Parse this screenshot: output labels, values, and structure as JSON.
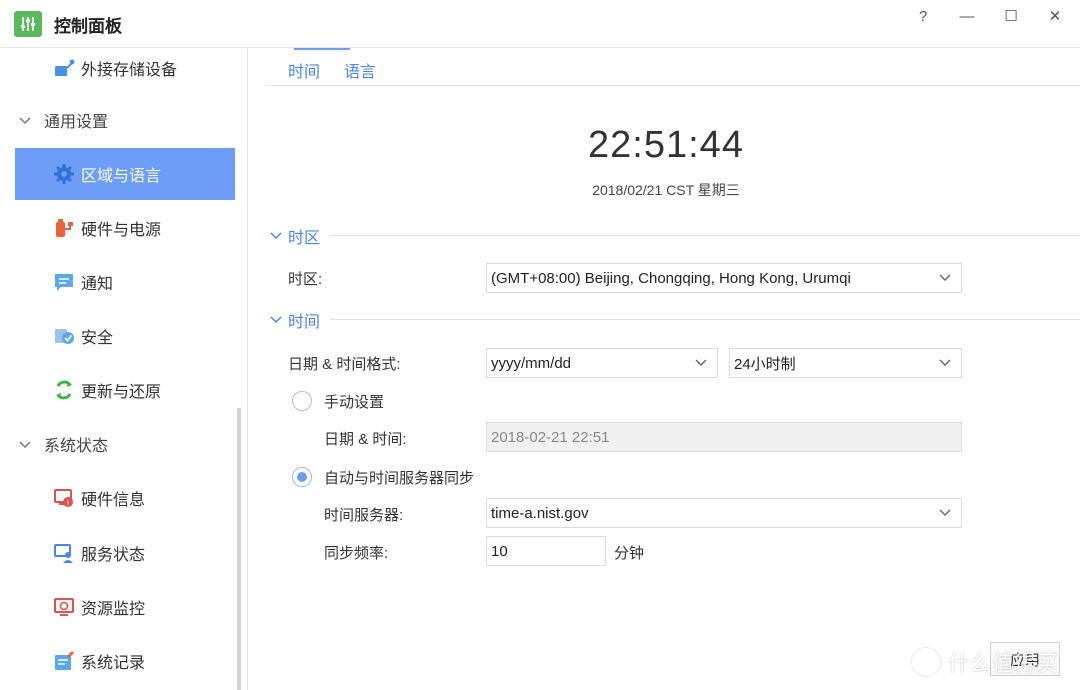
{
  "window": {
    "title": "控制面板",
    "help": "?",
    "minimize": "—",
    "maximize": "☐",
    "close": "✕"
  },
  "sidebar": {
    "items": [
      {
        "label": "外接存储设备",
        "icon": "external-storage-icon"
      },
      {
        "label": "通用设置",
        "type": "group"
      },
      {
        "label": "区域与语言",
        "icon": "gear-icon",
        "active": true
      },
      {
        "label": "硬件与电源",
        "icon": "power-icon"
      },
      {
        "label": "通知",
        "icon": "message-icon"
      },
      {
        "label": "安全",
        "icon": "shield-icon"
      },
      {
        "label": "更新与还原",
        "icon": "refresh-icon"
      },
      {
        "label": "系统状态",
        "type": "group"
      },
      {
        "label": "硬件信息",
        "icon": "hardware-info-icon"
      },
      {
        "label": "服务状态",
        "icon": "service-status-icon"
      },
      {
        "label": "资源监控",
        "icon": "resource-monitor-icon"
      },
      {
        "label": "系统记录",
        "icon": "system-log-icon"
      }
    ]
  },
  "tabs": [
    {
      "label": "时间",
      "active": true
    },
    {
      "label": "语言",
      "active": false
    }
  ],
  "clock": {
    "time": "22:51:44",
    "date": "2018/02/21 CST 星期三"
  },
  "timezone_section": {
    "title": "时区",
    "label": "时区:",
    "value": "(GMT+08:00) Beijing, Chongqing, Hong Kong, Urumqi"
  },
  "time_section": {
    "title": "时间",
    "format_label": "日期 & 时间格式:",
    "date_format": "yyyy/mm/dd",
    "hour_format": "24小时制",
    "manual_label": "手动设置",
    "manual_checked": false,
    "datetime_label": "日期 & 时间:",
    "datetime_value": "2018-02-21 22:51",
    "auto_label": "自动与时间服务器同步",
    "auto_checked": true,
    "server_label": "时间服务器:",
    "server_value": "time-a.nist.gov",
    "freq_label": "同步频率:",
    "freq_value": "10",
    "freq_unit": "分钟"
  },
  "footer": {
    "apply_label": "应用",
    "watermark": "什么值得买"
  },
  "colors": {
    "accent": "#6d9ef7",
    "link": "#4a86e8",
    "app_icon": "#5cb85c"
  }
}
